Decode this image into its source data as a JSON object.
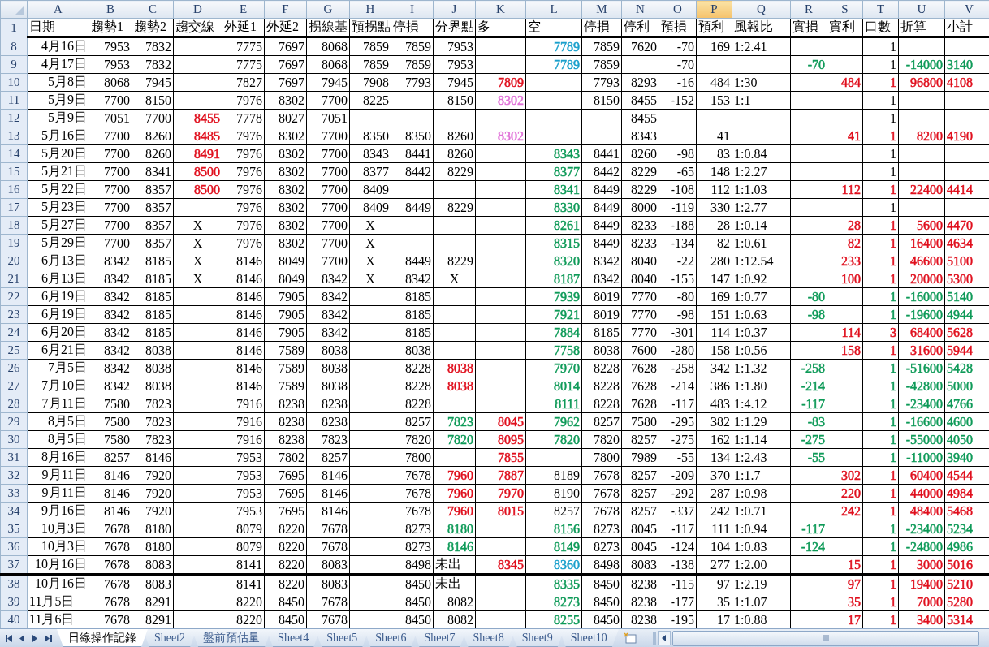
{
  "column_headers": [
    {
      "label": "A",
      "selected": false
    },
    {
      "label": "B",
      "selected": false
    },
    {
      "label": "C",
      "selected": false
    },
    {
      "label": "D",
      "selected": false
    },
    {
      "label": "E",
      "selected": false
    },
    {
      "label": "F",
      "selected": false
    },
    {
      "label": "G",
      "selected": false
    },
    {
      "label": "H",
      "selected": false
    },
    {
      "label": "I",
      "selected": false
    },
    {
      "label": "J",
      "selected": false
    },
    {
      "label": "K",
      "selected": false
    },
    {
      "label": "L",
      "selected": false
    },
    {
      "label": "M",
      "selected": false
    },
    {
      "label": "N",
      "selected": false
    },
    {
      "label": "O",
      "selected": false
    },
    {
      "label": "P",
      "selected": true
    },
    {
      "label": "Q",
      "selected": false
    },
    {
      "label": "R",
      "selected": false
    },
    {
      "label": "S",
      "selected": false
    },
    {
      "label": "T",
      "selected": false
    },
    {
      "label": "U",
      "selected": false
    },
    {
      "label": "V",
      "selected": false
    }
  ],
  "header_row": {
    "number": "1",
    "cells": [
      "日期",
      "趨勢1",
      "趨勢2",
      "趨交線",
      "外延1",
      "外延2",
      "拐線基",
      "預拐點",
      "停損",
      "分界點",
      "多",
      "空",
      "停損",
      "停利",
      "預損",
      "預利",
      "風報比",
      "實損",
      "實利",
      "口數",
      "折算",
      "小計"
    ]
  },
  "rows": [
    {
      "number": "8",
      "section_start": false,
      "cells": [
        "4月16日",
        "7953",
        "7832",
        "",
        "7775",
        "7697",
        "8068",
        "7859",
        "7859",
        "7953",
        "",
        {
          "text": "7789",
          "color": "#1aa0cc"
        },
        "7859",
        "7620",
        "-70",
        "169",
        "1:2.41",
        "",
        "",
        "1",
        "",
        ""
      ]
    },
    {
      "number": "9",
      "section_start": false,
      "cells": [
        "4月17日",
        "7953",
        "7832",
        "",
        "7775",
        "7697",
        "8068",
        "7859",
        "7859",
        "7953",
        "",
        {
          "text": "7789",
          "color": "#1aa0cc"
        },
        "7859",
        "",
        "-70",
        "",
        "",
        {
          "text": "-70",
          "color": "#0e9a58"
        },
        "",
        "1",
        {
          "text": "-14000",
          "color": "#0e9a58"
        },
        {
          "text": "3140",
          "color": "#0e9a58"
        }
      ]
    },
    {
      "number": "10",
      "section_start": false,
      "cells": [
        "5月8日",
        "8068",
        "7945",
        "",
        "7827",
        "7697",
        "7945",
        "7908",
        "7793",
        "7945",
        {
          "text": "7809",
          "color": "#e0101e"
        },
        "",
        "7793",
        "8293",
        "-16",
        "484",
        "1:30",
        "",
        {
          "text": "484",
          "color": "#e0101e"
        },
        {
          "text": "1",
          "color": "#e0101e"
        },
        {
          "text": "96800",
          "color": "#e0101e"
        },
        {
          "text": "4108",
          "color": "#e0101e"
        }
      ]
    },
    {
      "number": "11",
      "section_start": false,
      "cells": [
        "5月9日",
        "7700",
        "8150",
        "",
        "7976",
        "8302",
        "7700",
        "8225",
        "",
        "8150",
        {
          "text": "8302",
          "color": "#e070d8"
        },
        "",
        "8150",
        "8455",
        "-152",
        "153",
        "1:1",
        "",
        "",
        "1",
        "",
        ""
      ]
    },
    {
      "number": "12",
      "section_start": false,
      "cells": [
        "5月9日",
        "7051",
        "7700",
        {
          "text": "8455",
          "color": "#e0101e"
        },
        "7778",
        "8027",
        "7051",
        "",
        "",
        "",
        "",
        "",
        "",
        "8455",
        "",
        "",
        "",
        "",
        "",
        "1",
        "",
        ""
      ]
    },
    {
      "number": "13",
      "section_start": false,
      "cells": [
        "5月16日",
        "7700",
        "8260",
        {
          "text": "8485",
          "color": "#e0101e"
        },
        "7976",
        "8302",
        "7700",
        "8350",
        "8350",
        "8260",
        {
          "text": "8302",
          "color": "#e070d8"
        },
        "",
        "",
        "8343",
        "",
        "41",
        "",
        "",
        {
          "text": "41",
          "color": "#e0101e"
        },
        {
          "text": "1",
          "color": "#e0101e"
        },
        {
          "text": "8200",
          "color": "#e0101e"
        },
        {
          "text": "4190",
          "color": "#e0101e"
        }
      ]
    },
    {
      "number": "14",
      "section_start": false,
      "cells": [
        "5月20日",
        "7700",
        "8260",
        {
          "text": "8491",
          "color": "#e0101e"
        },
        "7976",
        "8302",
        "7700",
        "8343",
        "8441",
        "8260",
        "",
        {
          "text": "8343",
          "color": "#0e9a58"
        },
        "8441",
        "8260",
        "-98",
        "83",
        "1:0.84",
        "",
        "",
        "1",
        "",
        ""
      ]
    },
    {
      "number": "15",
      "section_start": false,
      "cells": [
        "5月21日",
        "7700",
        "8341",
        {
          "text": "8500",
          "color": "#e0101e"
        },
        "7976",
        "8302",
        "7700",
        "8377",
        "8442",
        "8229",
        "",
        {
          "text": "8377",
          "color": "#0e9a58"
        },
        "8442",
        "8229",
        "-65",
        "148",
        "1:2.27",
        "",
        "",
        "1",
        "",
        ""
      ]
    },
    {
      "number": "16",
      "section_start": false,
      "cells": [
        "5月22日",
        "7700",
        "8357",
        {
          "text": "8500",
          "color": "#e0101e"
        },
        "7976",
        "8302",
        "7700",
        "8409",
        "",
        "",
        "",
        {
          "text": "8341",
          "color": "#0e9a58"
        },
        "8449",
        "8229",
        "-108",
        "112",
        "1:1.03",
        "",
        {
          "text": "112",
          "color": "#e0101e"
        },
        {
          "text": "1",
          "color": "#e0101e"
        },
        {
          "text": "22400",
          "color": "#e0101e"
        },
        {
          "text": "4414",
          "color": "#e0101e"
        }
      ]
    },
    {
      "number": "17",
      "section_start": false,
      "cells": [
        "5月23日",
        "7700",
        "8357",
        "",
        "7976",
        "8302",
        "7700",
        "8409",
        "8449",
        "8229",
        "",
        {
          "text": "8330",
          "color": "#0e9a58"
        },
        "8449",
        "8000",
        "-119",
        "330",
        "1:2.77",
        "",
        "",
        "1",
        "",
        ""
      ]
    },
    {
      "number": "18",
      "section_start": false,
      "cells": [
        "5月27日",
        "7700",
        "8357",
        {
          "text": "X",
          "kind": "center"
        },
        "7976",
        "8302",
        "7700",
        {
          "text": "X",
          "kind": "center"
        },
        "",
        "",
        "",
        {
          "text": "8261",
          "color": "#0e9a58"
        },
        "8449",
        "8233",
        "-188",
        "28",
        "1:0.14",
        "",
        {
          "text": "28",
          "color": "#e0101e"
        },
        {
          "text": "1",
          "color": "#e0101e"
        },
        {
          "text": "5600",
          "color": "#e0101e"
        },
        {
          "text": "4470",
          "color": "#e0101e"
        }
      ]
    },
    {
      "number": "19",
      "section_start": false,
      "cells": [
        "5月29日",
        "7700",
        "8357",
        {
          "text": "X",
          "kind": "center"
        },
        "7976",
        "8302",
        "7700",
        {
          "text": "X",
          "kind": "center"
        },
        "",
        "",
        "",
        {
          "text": "8315",
          "color": "#0e9a58"
        },
        "8449",
        "8233",
        "-134",
        "82",
        "1:0.61",
        "",
        {
          "text": "82",
          "color": "#e0101e"
        },
        {
          "text": "1",
          "color": "#e0101e"
        },
        {
          "text": "16400",
          "color": "#e0101e"
        },
        {
          "text": "4634",
          "color": "#e0101e"
        }
      ]
    },
    {
      "number": "20",
      "section_start": false,
      "cells": [
        "6月13日",
        "8342",
        "8185",
        {
          "text": "X",
          "kind": "center"
        },
        "8146",
        "8049",
        "7700",
        {
          "text": "X",
          "kind": "center"
        },
        "8449",
        "8229",
        "",
        {
          "text": "8320",
          "color": "#0e9a58"
        },
        "8342",
        "8040",
        "-22",
        "280",
        "1:12.54",
        "",
        {
          "text": "233",
          "color": "#e0101e"
        },
        {
          "text": "1",
          "color": "#e0101e"
        },
        {
          "text": "46600",
          "color": "#e0101e"
        },
        {
          "text": "5100",
          "color": "#e0101e"
        }
      ]
    },
    {
      "number": "21",
      "section_start": false,
      "cells": [
        "6月13日",
        "8342",
        "8185",
        {
          "text": "X",
          "kind": "center"
        },
        "8146",
        "8049",
        "8342",
        {
          "text": "X",
          "kind": "center"
        },
        "8342",
        {
          "text": "X",
          "kind": "center"
        },
        "",
        {
          "text": "8187",
          "color": "#0e9a58"
        },
        "8342",
        "8040",
        "-155",
        "147",
        "1:0.92",
        "",
        {
          "text": "100",
          "color": "#e0101e"
        },
        {
          "text": "1",
          "color": "#e0101e"
        },
        {
          "text": "20000",
          "color": "#e0101e"
        },
        {
          "text": "5300",
          "color": "#e0101e"
        }
      ]
    },
    {
      "number": "22",
      "section_start": false,
      "cells": [
        "6月19日",
        "8342",
        "8185",
        "",
        "8146",
        "7905",
        "8342",
        "",
        "8185",
        "",
        "",
        {
          "text": "7939",
          "color": "#0e9a58"
        },
        "8019",
        "7770",
        "-80",
        "169",
        "1:0.77",
        {
          "text": "-80",
          "color": "#0e9a58"
        },
        "",
        {
          "text": "1",
          "color": "#0e9a58"
        },
        {
          "text": "-16000",
          "color": "#0e9a58"
        },
        {
          "text": "5140",
          "color": "#0e9a58"
        }
      ]
    },
    {
      "number": "23",
      "section_start": false,
      "cells": [
        "6月19日",
        "8342",
        "8185",
        "",
        "8146",
        "7905",
        "8342",
        "",
        "8185",
        "",
        "",
        {
          "text": "7921",
          "color": "#0e9a58"
        },
        "8019",
        "7770",
        "-98",
        "151",
        "1:0.63",
        {
          "text": "-98",
          "color": "#0e9a58"
        },
        "",
        {
          "text": "1",
          "color": "#0e9a58"
        },
        {
          "text": "-19600",
          "color": "#0e9a58"
        },
        {
          "text": "4944",
          "color": "#0e9a58"
        }
      ]
    },
    {
      "number": "24",
      "section_start": false,
      "cells": [
        "6月20日",
        "8342",
        "8185",
        "",
        "8146",
        "7905",
        "8342",
        "",
        "8185",
        "",
        "",
        {
          "text": "7884",
          "color": "#0e9a58"
        },
        "8185",
        "7770",
        "-301",
        "114",
        "1:0.37",
        "",
        {
          "text": "114",
          "color": "#e0101e"
        },
        {
          "text": "3",
          "color": "#e0101e"
        },
        {
          "text": "68400",
          "color": "#e0101e"
        },
        {
          "text": "5628",
          "color": "#e0101e"
        }
      ]
    },
    {
      "number": "25",
      "section_start": false,
      "cells": [
        "6月21日",
        "8342",
        "8038",
        "",
        "8146",
        "7589",
        "8038",
        "",
        "8038",
        "",
        "",
        {
          "text": "7758",
          "color": "#0e9a58"
        },
        "8038",
        "7600",
        "-280",
        "158",
        "1:0.56",
        "",
        {
          "text": "158",
          "color": "#e0101e"
        },
        {
          "text": "1",
          "color": "#e0101e"
        },
        {
          "text": "31600",
          "color": "#e0101e"
        },
        {
          "text": "5944",
          "color": "#e0101e"
        }
      ]
    },
    {
      "number": "26",
      "section_start": false,
      "cells": [
        "7月5日",
        "8342",
        "8038",
        "",
        "8146",
        "7589",
        "8038",
        "",
        "8228",
        {
          "text": "8038",
          "color": "#e0101e"
        },
        "",
        {
          "text": "7970",
          "color": "#0e9a58"
        },
        "8228",
        "7628",
        "-258",
        "342",
        "1:1.32",
        {
          "text": "-258",
          "color": "#0e9a58"
        },
        "",
        {
          "text": "1",
          "color": "#0e9a58"
        },
        {
          "text": "-51600",
          "color": "#0e9a58"
        },
        {
          "text": "5428",
          "color": "#0e9a58"
        }
      ]
    },
    {
      "number": "27",
      "section_start": false,
      "cells": [
        "7月10日",
        "8342",
        "8038",
        "",
        "8146",
        "7589",
        "8038",
        "",
        "8228",
        {
          "text": "8038",
          "color": "#e0101e"
        },
        "",
        {
          "text": "8014",
          "color": "#0e9a58"
        },
        "8228",
        "7628",
        "-214",
        "386",
        "1:1.80",
        {
          "text": "-214",
          "color": "#0e9a58"
        },
        "",
        {
          "text": "1",
          "color": "#0e9a58"
        },
        {
          "text": "-42800",
          "color": "#0e9a58"
        },
        {
          "text": "5000",
          "color": "#0e9a58"
        }
      ]
    },
    {
      "number": "28",
      "section_start": false,
      "cells": [
        "7月11日",
        "7580",
        "7823",
        "",
        "7916",
        "8238",
        "8238",
        "",
        "8228",
        "",
        "",
        {
          "text": "8111",
          "color": "#0e9a58"
        },
        "8228",
        "7628",
        "-117",
        "483",
        "1:4.12",
        {
          "text": "-117",
          "color": "#0e9a58"
        },
        "",
        {
          "text": "1",
          "color": "#0e9a58"
        },
        {
          "text": "-23400",
          "color": "#0e9a58"
        },
        {
          "text": "4766",
          "color": "#0e9a58"
        }
      ]
    },
    {
      "number": "29",
      "section_start": false,
      "cells": [
        "8月5日",
        "7580",
        "7823",
        "",
        "7916",
        "8238",
        "8238",
        "",
        "8257",
        {
          "text": "7823",
          "color": "#0e9a58"
        },
        {
          "text": "8045",
          "color": "#e0101e"
        },
        {
          "text": "7962",
          "color": "#0e9a58"
        },
        "8257",
        "7580",
        "-295",
        "382",
        "1:1.29",
        {
          "text": "-83",
          "color": "#0e9a58"
        },
        "",
        {
          "text": "1",
          "color": "#0e9a58"
        },
        {
          "text": "-16600",
          "color": "#0e9a58"
        },
        {
          "text": "4600",
          "color": "#0e9a58"
        }
      ]
    },
    {
      "number": "30",
      "section_start": false,
      "cells": [
        "8月5日",
        "7580",
        "7823",
        "",
        "7916",
        "8238",
        "7823",
        "",
        "7820",
        {
          "text": "7820",
          "color": "#0e9a58"
        },
        {
          "text": "8095",
          "color": "#e0101e"
        },
        {
          "text": "7820",
          "color": "#0e9a58"
        },
        "7820",
        "8257",
        "-275",
        "162",
        "1:1.14",
        {
          "text": "-275",
          "color": "#0e9a58"
        },
        "",
        {
          "text": "1",
          "color": "#0e9a58"
        },
        {
          "text": "-55000",
          "color": "#0e9a58"
        },
        {
          "text": "4050",
          "color": "#0e9a58"
        }
      ]
    },
    {
      "number": "31",
      "section_start": false,
      "cells": [
        "8月16日",
        "8257",
        "8146",
        "",
        "7953",
        "7802",
        "8257",
        "",
        "7800",
        "",
        {
          "text": "7855",
          "color": "#e0101e"
        },
        "",
        "7800",
        "7989",
        "-55",
        "134",
        "1:2.43",
        {
          "text": "-55",
          "color": "#0e9a58"
        },
        "",
        {
          "text": "1",
          "color": "#0e9a58"
        },
        {
          "text": "-11000",
          "color": "#0e9a58"
        },
        {
          "text": "3940",
          "color": "#0e9a58"
        }
      ]
    },
    {
      "number": "32",
      "section_start": false,
      "cells": [
        "9月11日",
        "8146",
        "7920",
        "",
        "7953",
        "7695",
        "8146",
        "",
        "7678",
        {
          "text": "7960",
          "color": "#e0101e"
        },
        {
          "text": "7887",
          "color": "#e0101e"
        },
        "8189",
        "7678",
        "8257",
        "-209",
        "370",
        "1:1.7",
        "",
        {
          "text": "302",
          "color": "#e0101e"
        },
        {
          "text": "1",
          "color": "#e0101e"
        },
        {
          "text": "60400",
          "color": "#e0101e"
        },
        {
          "text": "4544",
          "color": "#e0101e"
        }
      ]
    },
    {
      "number": "33",
      "section_start": false,
      "cells": [
        "9月11日",
        "8146",
        "7920",
        "",
        "7953",
        "7695",
        "8146",
        "",
        "7678",
        {
          "text": "7960",
          "color": "#e0101e"
        },
        {
          "text": "7970",
          "color": "#e0101e"
        },
        "8190",
        "7678",
        "8257",
        "-292",
        "287",
        "1:0.98",
        "",
        {
          "text": "220",
          "color": "#e0101e"
        },
        {
          "text": "1",
          "color": "#e0101e"
        },
        {
          "text": "44000",
          "color": "#e0101e"
        },
        {
          "text": "4984",
          "color": "#e0101e"
        }
      ]
    },
    {
      "number": "34",
      "section_start": false,
      "cells": [
        "9月16日",
        "8146",
        "7920",
        "",
        "7953",
        "7695",
        "8146",
        "",
        "7678",
        {
          "text": "7960",
          "color": "#e0101e"
        },
        {
          "text": "8015",
          "color": "#e0101e"
        },
        "8257",
        "7678",
        "8257",
        "-337",
        "242",
        "1:0.71",
        "",
        {
          "text": "242",
          "color": "#e0101e"
        },
        {
          "text": "1",
          "color": "#e0101e"
        },
        {
          "text": "48400",
          "color": "#e0101e"
        },
        {
          "text": "5468",
          "color": "#e0101e"
        }
      ]
    },
    {
      "number": "35",
      "section_start": false,
      "cells": [
        "10月3日",
        "7678",
        "8180",
        "",
        "8079",
        "8220",
        "7678",
        "",
        "8273",
        {
          "text": "8180",
          "color": "#0e9a58"
        },
        "",
        {
          "text": "8156",
          "color": "#0e9a58"
        },
        "8273",
        "8045",
        "-117",
        "111",
        "1:0.94",
        {
          "text": "-117",
          "color": "#0e9a58"
        },
        "",
        {
          "text": "1",
          "color": "#0e9a58"
        },
        {
          "text": "-23400",
          "color": "#0e9a58"
        },
        {
          "text": "5234",
          "color": "#0e9a58"
        }
      ]
    },
    {
      "number": "36",
      "section_start": false,
      "cells": [
        "10月3日",
        "7678",
        "8180",
        "",
        "8079",
        "8220",
        "7678",
        "",
        "8273",
        {
          "text": "8146",
          "color": "#0e9a58"
        },
        "",
        {
          "text": "8149",
          "color": "#0e9a58"
        },
        "8273",
        "8045",
        "-124",
        "104",
        "1:0.83",
        {
          "text": "-124",
          "color": "#0e9a58"
        },
        "",
        {
          "text": "1",
          "color": "#0e9a58"
        },
        {
          "text": "-24800",
          "color": "#0e9a58"
        },
        {
          "text": "4986",
          "color": "#0e9a58"
        }
      ]
    },
    {
      "number": "37",
      "section_start": false,
      "cells": [
        "10月16日",
        "7678",
        "8083",
        "",
        "8141",
        "8220",
        "8083",
        "",
        "8498",
        {
          "text": "未出",
          "kind": "left"
        },
        {
          "text": "8345",
          "color": "#e0101e"
        },
        {
          "text": "8360",
          "color": "#1aa0cc"
        },
        "8498",
        "8083",
        "-138",
        "277",
        "1:2.00",
        "",
        {
          "text": "15",
          "color": "#e0101e"
        },
        {
          "text": "1",
          "color": "#e0101e"
        },
        {
          "text": "3000",
          "color": "#e0101e"
        },
        {
          "text": "5016",
          "color": "#e0101e"
        }
      ]
    },
    {
      "number": "38",
      "section_start": true,
      "cells": [
        "10月16日",
        "7678",
        "8083",
        "",
        "8141",
        "8220",
        "8083",
        "",
        "8450",
        {
          "text": "未出",
          "kind": "left"
        },
        "",
        {
          "text": "8335",
          "color": "#0e9a58"
        },
        "8450",
        "8238",
        "-115",
        "97",
        "1:2.19",
        "",
        {
          "text": "97",
          "color": "#e0101e"
        },
        {
          "text": "1",
          "color": "#e0101e"
        },
        {
          "text": "19400",
          "color": "#e0101e"
        },
        {
          "text": "5210",
          "color": "#e0101e"
        }
      ]
    },
    {
      "number": "39",
      "section_start": false,
      "cells": [
        {
          "text": "11月5日",
          "kind": "left"
        },
        "7678",
        "8291",
        "",
        "8220",
        "8450",
        "7678",
        "",
        "8450",
        "8082",
        "",
        {
          "text": "8273",
          "color": "#0e9a58"
        },
        "8450",
        "8238",
        "-177",
        "35",
        "1:1.07",
        "",
        {
          "text": "35",
          "color": "#e0101e"
        },
        {
          "text": "1",
          "color": "#e0101e"
        },
        {
          "text": "7000",
          "color": "#e0101e"
        },
        {
          "text": "5280",
          "color": "#e0101e"
        }
      ]
    },
    {
      "number": "40",
      "section_start": false,
      "cells": [
        {
          "text": "11月6日",
          "kind": "left"
        },
        "7678",
        "8291",
        "",
        "8220",
        "8450",
        "7678",
        "",
        "8450",
        "8082",
        "",
        {
          "text": "8255",
          "color": "#0e9a58"
        },
        "8450",
        "8238",
        "-195",
        "17",
        "1:0.88",
        "",
        {
          "text": "17",
          "color": "#e0101e"
        },
        {
          "text": "1",
          "color": "#e0101e"
        },
        {
          "text": "3400",
          "color": "#e0101e"
        },
        {
          "text": "5314",
          "color": "#e0101e"
        }
      ]
    }
  ],
  "sheet_tabs": [
    {
      "label": "日線操作記錄",
      "selected": true
    },
    {
      "label": "Sheet2",
      "selected": false
    },
    {
      "label": "盤前預估量",
      "selected": false
    },
    {
      "label": "Sheet4",
      "selected": false
    },
    {
      "label": "Sheet5",
      "selected": false
    },
    {
      "label": "Sheet6",
      "selected": false
    },
    {
      "label": "Sheet7",
      "selected": false
    },
    {
      "label": "Sheet8",
      "selected": false
    },
    {
      "label": "Sheet9",
      "selected": false
    },
    {
      "label": "Sheet10",
      "selected": false
    }
  ]
}
